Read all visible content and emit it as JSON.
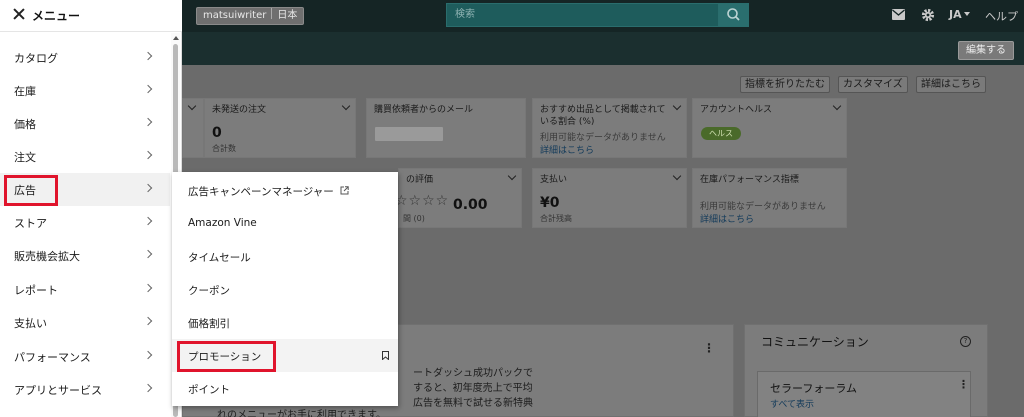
{
  "topbar": {
    "account_name": "matsuiwriter",
    "marketplace": "日本",
    "search_placeholder": "検索",
    "language": "JA",
    "help": "ヘルプ",
    "icons": [
      "mail-icon",
      "gear-icon",
      "search-icon"
    ]
  },
  "subbar": {
    "edit_label": "編集する"
  },
  "toolbar": {
    "collapse_label": "指標を折りたたむ",
    "customize_label": "カスタマイズ",
    "details_label": "詳細はこちら"
  },
  "cards": {
    "unshipped": {
      "title": "未発送の注文",
      "value": "0",
      "sub": "合計数"
    },
    "buyer_messages": {
      "title": "購買依頼者からのメール"
    },
    "featured_offer": {
      "title_line1": "おすすめ出品として掲載されて",
      "title_line2": "いる割合 (%)",
      "note": "利用可能なデータがありません",
      "link": "詳細はこちら"
    },
    "account_health": {
      "title": "アカウントヘルス",
      "badge": "ヘルス"
    },
    "feedback": {
      "title": "の評価",
      "rating": "0.00",
      "sub": "間 (0)"
    },
    "payments": {
      "title": "支払い",
      "value": "¥0",
      "sub": "合計残高"
    },
    "inventory_perf": {
      "title": "在庫パフォーマンス指標",
      "note": "利用可能なデータがありません",
      "link": "詳細はこちら"
    }
  },
  "bottom": {
    "line1": "ートダッシュ成功パックで",
    "line2": "すると、初年度売上で平均",
    "line3": "広告を無料で試せる新特典",
    "footer": "れのメニューがお手に利用できます。"
  },
  "communication": {
    "title": "コミュニケーション",
    "forum_title": "セラーフォーラム",
    "forum_link": "すべて表示"
  },
  "main_menu": {
    "title": "メニュー",
    "items": [
      {
        "label": "カタログ"
      },
      {
        "label": "在庫"
      },
      {
        "label": "価格"
      },
      {
        "label": "注文"
      },
      {
        "label": "広告"
      },
      {
        "label": "ストア"
      },
      {
        "label": "販売機会拡大"
      },
      {
        "label": "レポート"
      },
      {
        "label": "支払い"
      },
      {
        "label": "パフォーマンス"
      },
      {
        "label": "アプリとサービス"
      }
    ]
  },
  "sub_menu": {
    "items": [
      {
        "label": "広告キャンペーンマネージャー"
      },
      {
        "label": "Amazon Vine"
      },
      {
        "label": "タイムセール"
      },
      {
        "label": "クーポン"
      },
      {
        "label": "価格割引"
      },
      {
        "label": "プロモーション"
      },
      {
        "label": "ポイント"
      }
    ]
  },
  "colors": {
    "highlight": "#e0142c",
    "topbar": "#152525",
    "search": "#1e5c5c"
  }
}
